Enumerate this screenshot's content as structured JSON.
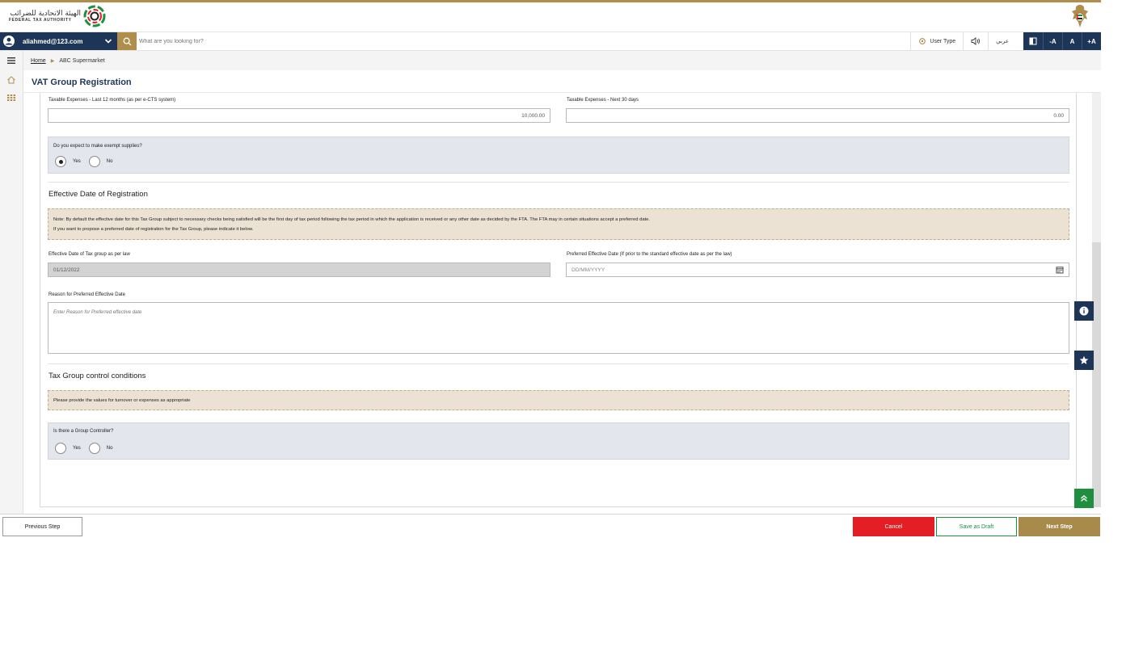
{
  "colors": {
    "navy": "#1d3557",
    "gold": "#b08d4a",
    "red": "#e31e24",
    "green": "#1e8f3f",
    "panel": "#e3e6ec",
    "note": "#ebe2d3"
  },
  "header": {
    "logo_ar": "الهيئة الاتحادية للضرائب",
    "logo_en": "FEDERAL TAX AUTHORITY"
  },
  "nav": {
    "user_email": "aliahmed@123.com",
    "search_placeholder": "What are you looking for?",
    "user_type": "User Type",
    "language": "عربي",
    "font_decrease": "-A",
    "font_normal": "A",
    "font_increase": "+A"
  },
  "breadcrumb": {
    "home": "Home",
    "current": "ABC Supermarket"
  },
  "page": {
    "title": "VAT Group Registration"
  },
  "expenses": {
    "last12_label": "Taxable Expenses - Last 12 months (as per e-CTS system)",
    "last12_value": "10,000.00",
    "next30_label": "Taxable Expenses - Next 30 days",
    "next30_value": "0.00"
  },
  "exempt": {
    "question": "Do you expect to make exempt supplies?",
    "yes": "Yes",
    "no": "No",
    "selected": "Yes"
  },
  "effective_date": {
    "section_title": "Effective Date of Registration",
    "note_line1": "Note: By default the effective date for this Tax Group subject to necessary checks being satisfied will be the first day of tax period following the tax period in which the application is received or any other date as decided by the FTA. The FTA may in certain situations accept a preferred date.",
    "note_line2": "If you want to propose a preferred date of registration for the Tax Group, please indicate it below.",
    "law_label": "Effective Date of Tax group as per law",
    "law_value": "01/12/2022",
    "preferred_label": "Preferred Effective Date (If prior to the standard effective date as per the law)",
    "preferred_placeholder": "DD/MM/YYYY",
    "reason_label": "Reason for Preferred Effective Date",
    "reason_placeholder": "Enter Reason for Preferred effective date"
  },
  "control": {
    "section_title": "Tax Group control conditions",
    "note": "Please provide the values for turnover or expenses as appropriate",
    "question": "Is there a Group Controller?",
    "yes": "Yes",
    "no": "No"
  },
  "footer": {
    "previous": "Previous Step",
    "cancel": "Cancel",
    "save_draft": "Save as Draft",
    "next": "Next Step"
  }
}
